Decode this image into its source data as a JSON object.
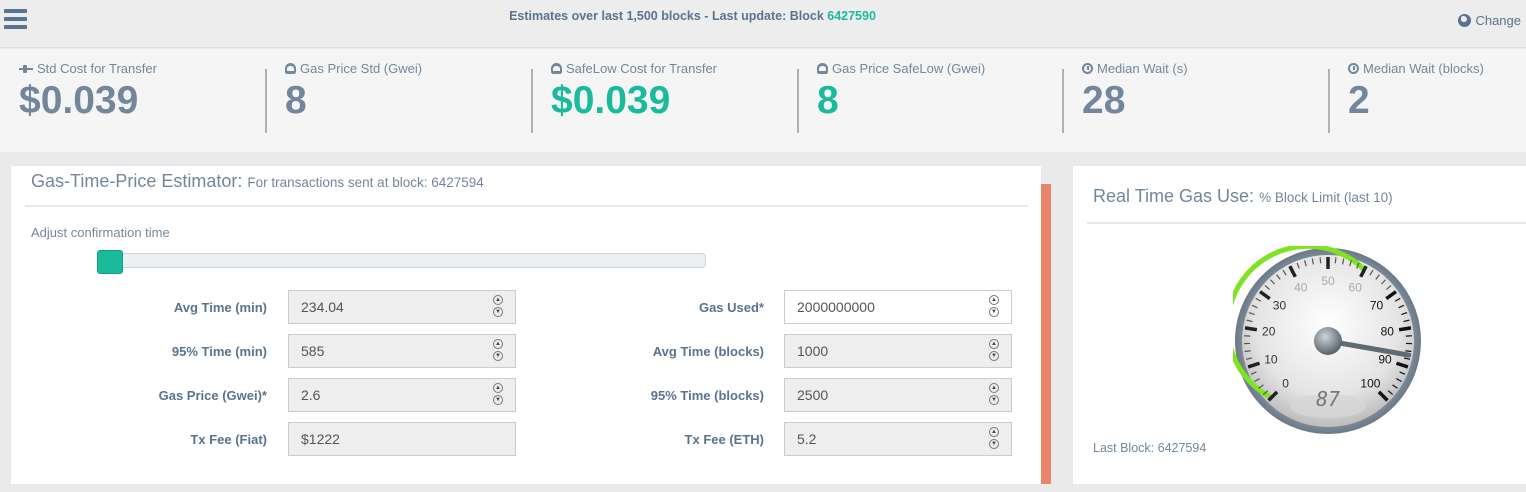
{
  "topbar": {
    "title_prefix": "Estimates over last 1,500 blocks - Last update: Block ",
    "title_block": "6427590",
    "change_label": "Change"
  },
  "tiles": [
    {
      "label": "Std Cost for Transfer",
      "value": "$0.039",
      "icon": "plane-icon",
      "accent": false
    },
    {
      "label": "Gas Price Std (Gwei)",
      "value": "8",
      "icon": "gauge-icon",
      "accent": false
    },
    {
      "label": "SafeLow Cost for Transfer",
      "value": "$0.039",
      "icon": "gauge-icon",
      "accent": true
    },
    {
      "label": "Gas Price SafeLow (Gwei)",
      "value": "8",
      "icon": "gauge-icon",
      "accent": true
    },
    {
      "label": "Median Wait (s)",
      "value": "28",
      "icon": "clock-icon",
      "accent": false
    },
    {
      "label": "Median Wait (blocks)",
      "value": "2",
      "icon": "clock-icon",
      "accent": false
    }
  ],
  "estimator": {
    "title": "Gas-Time-Price Estimator:",
    "subtitle": "For transactions sent at block: 6427594",
    "adjust_label": "Adjust confirmation time",
    "slider_position": 0.0,
    "left_fields": [
      {
        "label": "Avg Time (min)",
        "value": "234.04"
      },
      {
        "label": "95% Time (min)",
        "value": "585"
      },
      {
        "label": "Gas Price (Gwei)*",
        "value": "2.6"
      },
      {
        "label": "Tx Fee (Fiat)",
        "value": "$1222"
      }
    ],
    "right_fields": [
      {
        "label": "Gas Used*",
        "value": "2000000000"
      },
      {
        "label": "Avg Time (blocks)",
        "value": "1000"
      },
      {
        "label": "95% Time (blocks)",
        "value": "2500"
      },
      {
        "label": "Tx Fee (ETH)",
        "value": "5.2"
      }
    ]
  },
  "gas_use": {
    "title": "Real Time Gas Use:",
    "subtitle": "% Block Limit (last 10)",
    "gauge_value": 87,
    "gauge_display": "87",
    "gauge_ticks": [
      "0",
      "10",
      "20",
      "30",
      "40",
      "50",
      "60",
      "70",
      "80",
      "90",
      "100"
    ],
    "last_block": "Last Block: 6427594"
  },
  "colors": {
    "accent": "#1abb9c",
    "text": "#73879c",
    "scroll": "#e9856a",
    "gauge_arc": "#7ee321"
  }
}
